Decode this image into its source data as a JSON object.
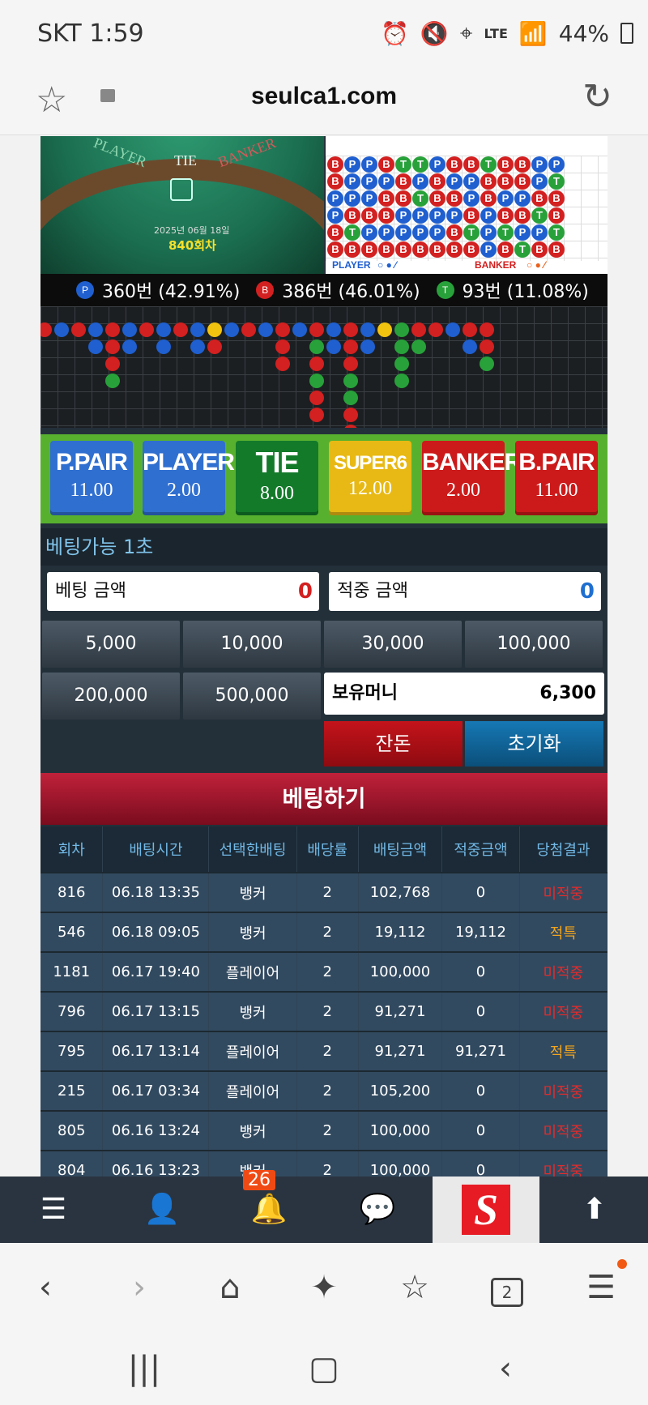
{
  "status": {
    "carrier_time": "SKT 1:59",
    "battery": "44%",
    "network": "LTE"
  },
  "browser": {
    "url": "seulca1.com"
  },
  "table": {
    "player_label": "PLAYER",
    "tie_label": "TIE",
    "banker_label": "BANKER",
    "date": "2025년 06월 18일",
    "round": "840회차"
  },
  "roadmap_legend": {
    "player": "PLAYER",
    "banker": "BANKER"
  },
  "stats": {
    "p_letter": "P",
    "p_text": "360번 (42.91%)",
    "b_letter": "B",
    "b_text": "386번 (46.01%)",
    "t_letter": "T",
    "t_text": "93번 (11.08%)"
  },
  "bets": [
    {
      "name": "P.PAIR",
      "odds": "11.00",
      "color": "#2f6fd0"
    },
    {
      "name": "PLAYER",
      "odds": "2.00",
      "color": "#2f6fd0"
    },
    {
      "name": "TIE",
      "odds": "8.00",
      "color": "#137a2a"
    },
    {
      "name": "SUPER6",
      "odds": "12.00",
      "color": "#e8b914"
    },
    {
      "name": "BANKER",
      "odds": "2.00",
      "color": "#cc1a1a"
    },
    {
      "name": "B.PAIR",
      "odds": "11.00",
      "color": "#cc1a1a"
    }
  ],
  "timer": "베팅가능 1초",
  "bet_amount": {
    "label": "베팅 금액",
    "value": "0"
  },
  "win_amount": {
    "label": "적중 금액",
    "value": "0"
  },
  "chips": [
    "5,000",
    "10,000",
    "30,000",
    "100,000",
    "200,000",
    "500,000"
  ],
  "balance": {
    "label": "보유머니",
    "value": "6,300"
  },
  "actions": {
    "change": "잔돈",
    "reset": "초기화"
  },
  "place_bet": "베팅하기",
  "history": {
    "headers": [
      "회차",
      "배팅시간",
      "선택한배팅",
      "배당률",
      "배팅금액",
      "적중금액",
      "당첨결과"
    ],
    "rows": [
      [
        "816",
        "06.18 13:35",
        "뱅커",
        "2",
        "102,768",
        "0",
        "미적중"
      ],
      [
        "546",
        "06.18 09:05",
        "뱅커",
        "2",
        "19,112",
        "19,112",
        "적특"
      ],
      [
        "1181",
        "06.17 19:40",
        "플레이어",
        "2",
        "100,000",
        "0",
        "미적중"
      ],
      [
        "796",
        "06.17 13:15",
        "뱅커",
        "2",
        "91,271",
        "0",
        "미적중"
      ],
      [
        "795",
        "06.17 13:14",
        "플레이어",
        "2",
        "91,271",
        "91,271",
        "적특"
      ],
      [
        "215",
        "06.17 03:34",
        "플레이어",
        "2",
        "105,200",
        "0",
        "미적중"
      ],
      [
        "805",
        "06.16 13:24",
        "뱅커",
        "2",
        "100,000",
        "0",
        "미적중"
      ],
      [
        "804",
        "06.16 13:23",
        "뱅커",
        "2",
        "100,000",
        "0",
        "미적중"
      ]
    ]
  },
  "nav": {
    "badge": "26"
  },
  "tabs_count": "2"
}
